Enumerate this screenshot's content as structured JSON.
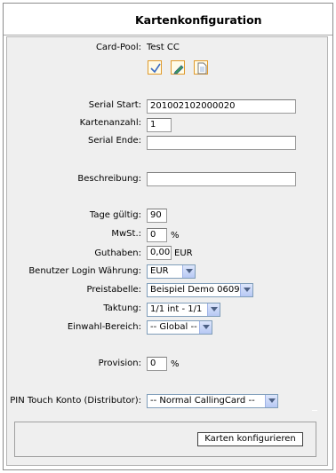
{
  "header": {
    "title": "Kartenkonfiguration"
  },
  "card_pool": {
    "label": "Card-Pool:",
    "value": "Test CC"
  },
  "actions": {
    "icons": [
      "check-icon",
      "pencil-edit-icon",
      "document-icon"
    ],
    "accent": "#e09a2c"
  },
  "fields": {
    "serial_start": {
      "label": "Serial Start:",
      "value": "201002102000020"
    },
    "card_count": {
      "label": "Kartenanzahl:",
      "value": "1"
    },
    "serial_end": {
      "label": "Serial Ende:",
      "value": ""
    },
    "description": {
      "label": "Beschreibung:",
      "value": ""
    },
    "days_valid": {
      "label": "Tage gültig:",
      "value": "90"
    },
    "vat": {
      "label": "MwSt.:",
      "value": "0",
      "unit": "%"
    },
    "balance": {
      "label": "Guthaben:",
      "value": "0,00",
      "unit": "EUR"
    },
    "login_currency": {
      "label": "Benutzer Login Währung:",
      "selected": "EUR"
    },
    "price_table": {
      "label": "Preistabelle:",
      "selected": "Beispiel Demo 0609"
    },
    "billing": {
      "label": "Taktung:",
      "selected": "1/1 int - 1/1"
    },
    "dial_in_area": {
      "label": "Einwahl-Bereich:",
      "selected": "-- Global --"
    },
    "commission": {
      "label": "Provision:",
      "value": "0",
      "unit": "%"
    },
    "pin_touch_account": {
      "label": "PIN Touch Konto (Distributor):",
      "selected": "-- Normal CallingCard --"
    }
  },
  "submit": {
    "label": "Karten konfigurieren"
  }
}
